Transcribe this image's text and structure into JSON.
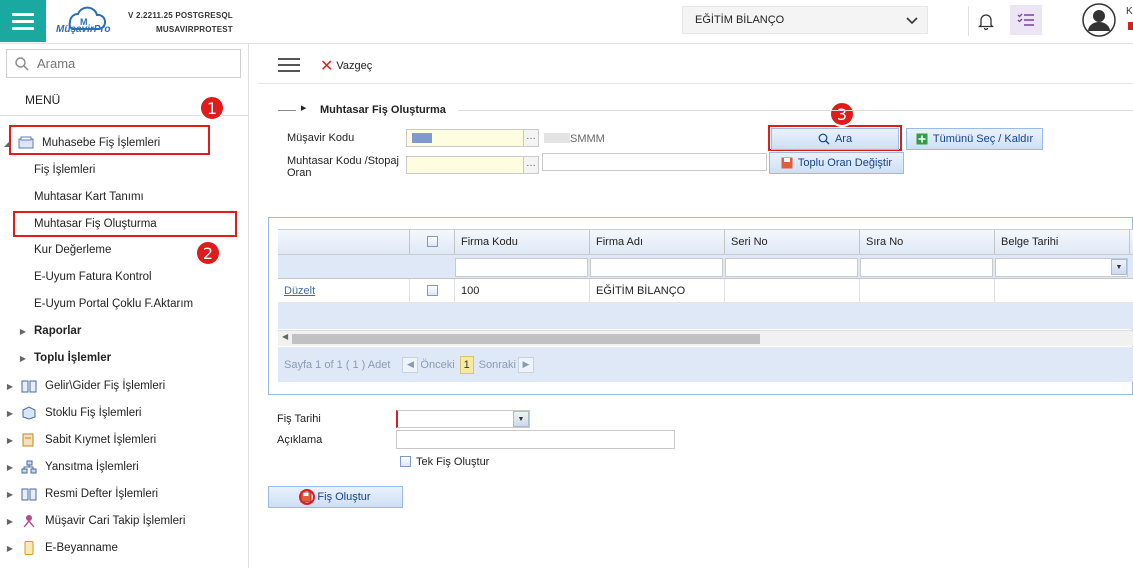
{
  "header": {
    "version": "V 2.2211.25 POSTGRESQL",
    "tenant": "MUSAVIRPROTEST",
    "logo_text": "MüşavirPro",
    "company_select": "EĞİTİM BİLANÇO",
    "edge_letter": "K"
  },
  "sidebar": {
    "search_placeholder": "Arama",
    "menu_title": "MENÜ",
    "items": [
      {
        "label": "Muhasebe Fiş İşlemleri",
        "icon": "ledger-icon"
      },
      {
        "label": "Fiş İşlemleri"
      },
      {
        "label": "Muhtasar Kart Tanımı"
      },
      {
        "label": "Muhtasar Fiş Oluşturma"
      },
      {
        "label": "Kur Değerleme"
      },
      {
        "label": "E-Uyum Fatura Kontrol"
      },
      {
        "label": "E-Uyum Portal Çoklu F.Aktarım"
      },
      {
        "label": "Raporlar"
      },
      {
        "label": "Toplu İşlemler"
      },
      {
        "label": "Gelir\\Gider Fiş İşlemleri",
        "icon": "book-icon"
      },
      {
        "label": "Stoklu Fiş İşlemleri",
        "icon": "box-icon"
      },
      {
        "label": "Sabit Kıymet İşlemleri",
        "icon": "asset-icon"
      },
      {
        "label": "Yansıtma İşlemleri",
        "icon": "network-icon"
      },
      {
        "label": "Resmi Defter İşlemleri",
        "icon": "book-icon"
      },
      {
        "label": "Müşavir Cari Takip İşlemleri",
        "icon": "person-icon"
      },
      {
        "label": "E-Beyanname",
        "icon": "document-icon"
      }
    ]
  },
  "badges": {
    "one": "1",
    "two": "2",
    "three": "3"
  },
  "toolbar": {
    "cancel_label": "Vazgeç"
  },
  "form": {
    "section_title": "Muhtasar Fiş Oluşturma",
    "musavir_kodu_label": "Müşavir Kodu",
    "musavir_suffix": "SMMM",
    "muhtasar_kodu_label_1": "Muhtasar Kodu /Stopaj",
    "muhtasar_kodu_label_2": "Oran",
    "search_button": "Ara",
    "select_all_button": "Tümünü Seç / Kaldır",
    "bulk_rate_button": "Toplu Oran Değiştir",
    "fis_tarihi_label": "Fiş Tarihi",
    "aciklama_label": "Açıklama",
    "tek_fis_label": "Tek Fiş Oluştur",
    "create_button": "Fiş Oluştur"
  },
  "grid": {
    "columns": [
      "Firma Kodu",
      "Firma Adı",
      "Seri No",
      "Sıra No",
      "Belge Tarihi"
    ],
    "rows": [
      {
        "action": "Düzelt",
        "firma_kodu": "100",
        "firma_adi": "EĞİTİM BİLANÇO"
      }
    ],
    "pager_text": "Sayfa 1 of 1 ( 1 ) Adet",
    "prev_label": "Önceki",
    "page_number": "1",
    "next_label": "Sonraki"
  },
  "colors": {
    "accent": "#1aa9a0",
    "annotation_red": "#e01b1b",
    "grid_blue": "#dfe8f6"
  }
}
